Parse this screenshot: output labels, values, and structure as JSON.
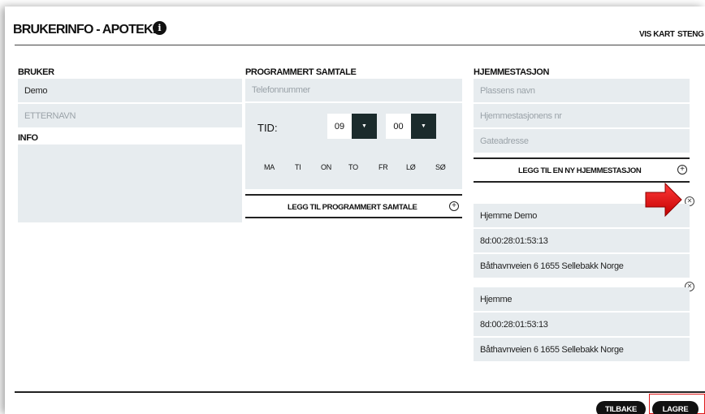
{
  "header": {
    "title": "BRUKERINFO - APOTEK1",
    "info_icon": "info-icon",
    "links": {
      "map": "VIS KART",
      "close": "STENG"
    }
  },
  "bruker": {
    "label": "BRUKER",
    "first_name_value": "Demo",
    "last_name_placeholder": "ETTERNAVN",
    "info_label": "INFO"
  },
  "program": {
    "label": "PROGRAMMERT SAMTALE",
    "phone_placeholder": "Telefonnummer",
    "time_label": "TID:",
    "hour": "09",
    "minute": "00",
    "dropdown_glyph": "▼",
    "days": [
      "MA",
      "TI",
      "ON",
      "TO",
      "FR",
      "LØ",
      "SØ"
    ],
    "add_label": "LEGG TIL PROGRAMMERT SAMTALE"
  },
  "station": {
    "label": "HJEMMESTASJON",
    "name_placeholder": "Plassens navn",
    "number_placeholder": "Hjemmestasjonens nr",
    "address_placeholder": "Gateadresse",
    "add_label": "LEGG TIL EN NY HJEMMESTASJON",
    "items": [
      {
        "name": "Hjemme Demo",
        "mac": "8d:00:28:01:53:13",
        "address": "Båthavnveien 6 1655 Sellebakk Norge"
      },
      {
        "name": "Hjemme",
        "mac": "8d:00:28:01:53:13",
        "address": "Båthavnveien 6 1655 Sellebakk Norge"
      }
    ]
  },
  "footer": {
    "back": "TILBAKE",
    "save": "LAGRE"
  },
  "colors": {
    "field_bg": "#e7ecef",
    "dark_button": "#1b2b2c",
    "arrow": "#e01b1b"
  }
}
